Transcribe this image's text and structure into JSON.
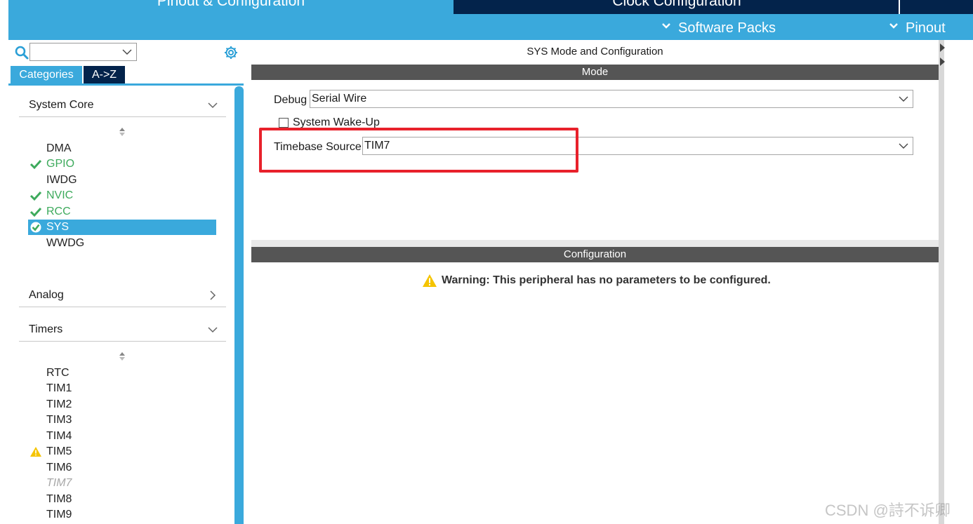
{
  "top_tabs": {
    "pinout_config": "Pinout & Configuration",
    "clock_config": "Clock Configuration"
  },
  "sub_menu": {
    "software_packs": "Software Packs",
    "pinout": "Pinout"
  },
  "left_panel": {
    "search": {
      "value": ""
    },
    "tabs": {
      "categories": "Categories",
      "az": "A->Z"
    },
    "sections": {
      "system_core": {
        "label": "System Core",
        "items": [
          {
            "name": "DMA",
            "status": "none"
          },
          {
            "name": "GPIO",
            "status": "ok"
          },
          {
            "name": "IWDG",
            "status": "none"
          },
          {
            "name": "NVIC",
            "status": "ok"
          },
          {
            "name": "RCC",
            "status": "ok"
          },
          {
            "name": "SYS",
            "status": "selected"
          },
          {
            "name": "WWDG",
            "status": "none"
          }
        ]
      },
      "analog": {
        "label": "Analog"
      },
      "timers": {
        "label": "Timers",
        "items": [
          {
            "name": "RTC",
            "status": "none"
          },
          {
            "name": "TIM1",
            "status": "none"
          },
          {
            "name": "TIM2",
            "status": "none"
          },
          {
            "name": "TIM3",
            "status": "none"
          },
          {
            "name": "TIM4",
            "status": "none"
          },
          {
            "name": "TIM5",
            "status": "warning"
          },
          {
            "name": "TIM6",
            "status": "none"
          },
          {
            "name": "TIM7",
            "status": "disabled"
          },
          {
            "name": "TIM8",
            "status": "none"
          },
          {
            "name": "TIM9",
            "status": "none"
          }
        ]
      }
    }
  },
  "main_panel": {
    "title": "SYS Mode and Configuration",
    "mode_header": "Mode",
    "debug": {
      "label": "Debug",
      "value": "Serial Wire"
    },
    "system_wakeup": {
      "label": "System Wake-Up",
      "checked": false
    },
    "timebase": {
      "label": "Timebase Source",
      "value": "TIM7"
    },
    "config_header": "Configuration",
    "warning": "Warning: This peripheral has no parameters to be configured."
  },
  "watermark": "CSDN @詩不诉卿",
  "colors": {
    "accent": "#3aa9dc",
    "dark_navy": "#03234b",
    "ok_green": "#3daa5c",
    "highlight_red": "#e8212b",
    "bar_gray": "#555555",
    "warning_yellow": "#f5c400"
  }
}
